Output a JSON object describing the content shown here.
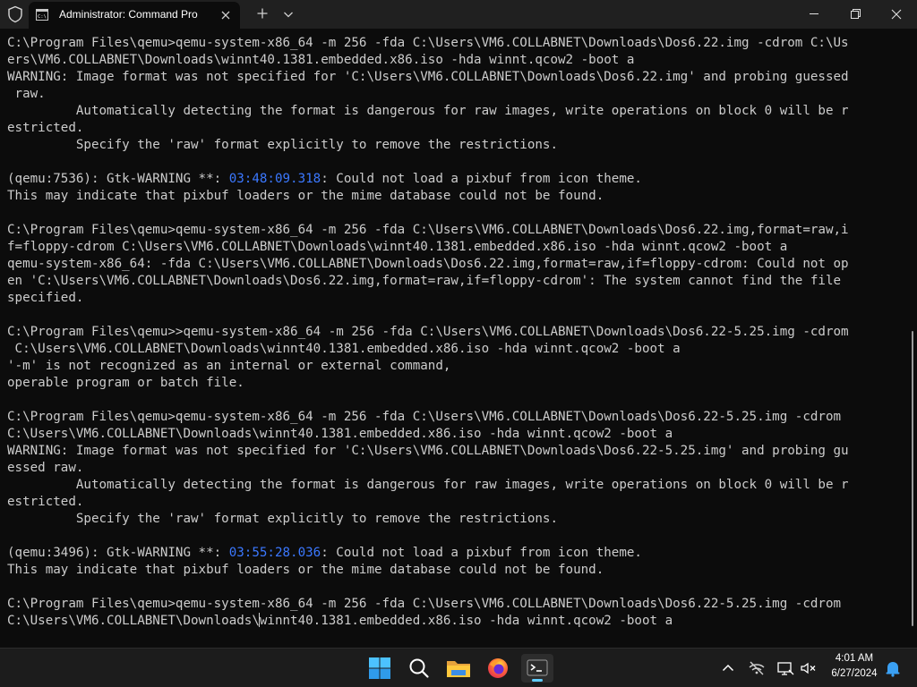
{
  "window": {
    "tab_title": "Administrator: Command Pro",
    "tab_icon": "cmd-icon"
  },
  "terminal": {
    "lines": [
      "C:\\Program Files\\qemu>qemu-system-x86_64 -m 256 -fda C:\\Users\\VM6.COLLABNET\\Downloads\\Dos6.22.img -cdrom C:\\Us",
      "ers\\VM6.COLLABNET\\Downloads\\winnt40.1381.embedded.x86.iso -hda winnt.qcow2 -boot a",
      "WARNING: Image format was not specified for 'C:\\Users\\VM6.COLLABNET\\Downloads\\Dos6.22.img' and probing guessed",
      " raw.",
      "         Automatically detecting the format is dangerous for raw images, write operations on block 0 will be r",
      "estricted.",
      "         Specify the 'raw' format explicitly to remove the restrictions.",
      "",
      "(qemu:7536): Gtk-WARNING **: 03:48:09.318: Could not load a pixbuf from icon theme.",
      "This may indicate that pixbuf loaders or the mime database could not be found.",
      "",
      "C:\\Program Files\\qemu>qemu-system-x86_64 -m 256 -fda C:\\Users\\VM6.COLLABNET\\Downloads\\Dos6.22.img,format=raw,i",
      "f=floppy-cdrom C:\\Users\\VM6.COLLABNET\\Downloads\\winnt40.1381.embedded.x86.iso -hda winnt.qcow2 -boot a",
      "qemu-system-x86_64: -fda C:\\Users\\VM6.COLLABNET\\Downloads\\Dos6.22.img,format=raw,if=floppy-cdrom: Could not op",
      "en 'C:\\Users\\VM6.COLLABNET\\Downloads\\Dos6.22.img,format=raw,if=floppy-cdrom': The system cannot find the file",
      "specified.",
      "",
      "C:\\Program Files\\qemu>>qemu-system-x86_64 -m 256 -fda C:\\Users\\VM6.COLLABNET\\Downloads\\Dos6.22-5.25.img -cdrom",
      " C:\\Users\\VM6.COLLABNET\\Downloads\\winnt40.1381.embedded.x86.iso -hda winnt.qcow2 -boot a",
      "'-m' is not recognized as an internal or external command,",
      "operable program or batch file.",
      "",
      "C:\\Program Files\\qemu>qemu-system-x86_64 -m 256 -fda C:\\Users\\VM6.COLLABNET\\Downloads\\Dos6.22-5.25.img -cdrom",
      "C:\\Users\\VM6.COLLABNET\\Downloads\\winnt40.1381.embedded.x86.iso -hda winnt.qcow2 -boot a",
      "WARNING: Image format was not specified for 'C:\\Users\\VM6.COLLABNET\\Downloads\\Dos6.22-5.25.img' and probing gu",
      "essed raw.",
      "         Automatically detecting the format is dangerous for raw images, write operations on block 0 will be r",
      "estricted.",
      "         Specify the 'raw' format explicitly to remove the restrictions.",
      "",
      "(qemu:3496): Gtk-WARNING **: 03:55:28.036: Could not load a pixbuf from icon theme.",
      "This may indicate that pixbuf loaders or the mime database could not be found.",
      "",
      "C:\\Program Files\\qemu>qemu-system-x86_64 -m 256 -fda C:\\Users\\VM6.COLLABNET\\Downloads\\Dos6.22-5.25.img -cdrom",
      "C:\\Users\\VM6.COLLABNET\\Downloads\\winnt40.1381.embedded.x86.iso -hda winnt.qcow2 -boot a"
    ],
    "highlighted_timestamps": [
      "03:48:09.318",
      "03:55:28.036"
    ],
    "timestamp_color": "#3b78ff",
    "text_color": "#cccccc",
    "background_color": "#0c0c0c"
  },
  "taskbar": {
    "apps": [
      {
        "name": "start-button",
        "icon": "windows-logo-icon"
      },
      {
        "name": "search-button",
        "icon": "search-icon"
      },
      {
        "name": "file-explorer",
        "icon": "folder-icon"
      },
      {
        "name": "firefox",
        "icon": "firefox-icon"
      },
      {
        "name": "terminal",
        "icon": "terminal-icon",
        "active": true
      }
    ],
    "tray_icons": [
      "chevron-up-icon",
      "network-off-icon",
      "display-icon",
      "volume-muted-icon"
    ],
    "time": "4:01 AM",
    "date": "6/27/2024",
    "notification_icon": "bell-icon",
    "accent_color": "#60cdff"
  }
}
